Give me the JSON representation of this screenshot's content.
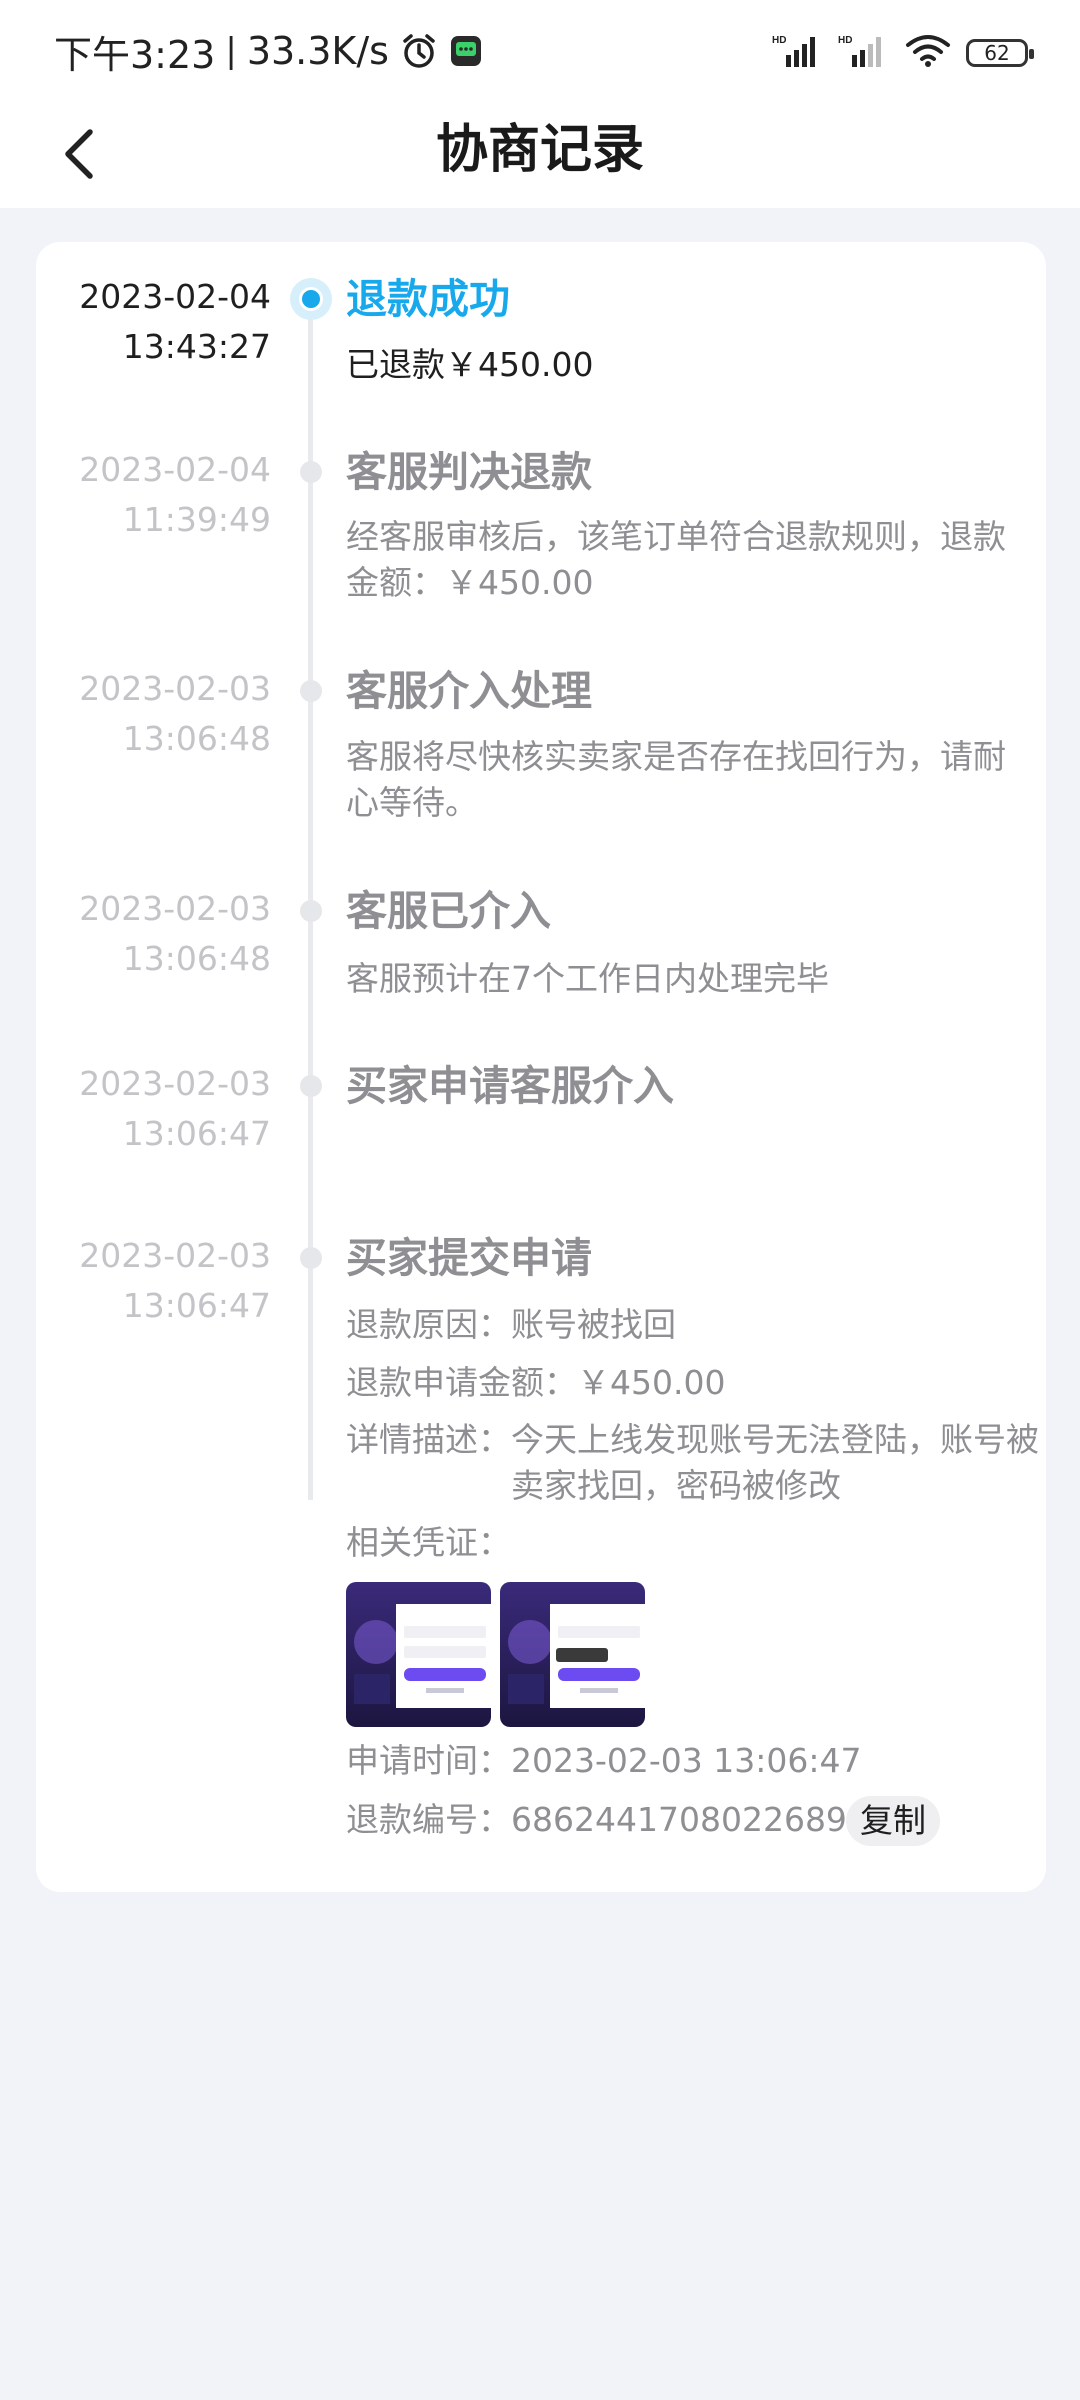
{
  "status_bar": {
    "time": "下午3:23",
    "separator": "|",
    "net_speed": "33.3K/s",
    "battery": "62",
    "signal_label_1": "HD",
    "signal_label_2": "HD"
  },
  "header": {
    "title": "协商记录"
  },
  "timeline": [
    {
      "date": "2023-02-04",
      "time": "13:43:27",
      "title": "退款成功",
      "text": "已退款￥450.00",
      "active": true
    },
    {
      "date": "2023-02-04",
      "time": "11:39:49",
      "title": "客服判决退款",
      "text": "经客服审核后，该笔订单符合退款规则，退款金额：￥450.00"
    },
    {
      "date": "2023-02-03",
      "time": "13:06:48",
      "title": "客服介入处理",
      "text": "客服将尽快核实卖家是否存在找回行为，请耐心等待。"
    },
    {
      "date": "2023-02-03",
      "time": "13:06:48",
      "title": "客服已介入",
      "text": "客服预计在7个工作日内处理完毕"
    },
    {
      "date": "2023-02-03",
      "time": "13:06:47",
      "title": "买家申请客服介入",
      "text": ""
    },
    {
      "date": "2023-02-03",
      "time": "13:06:47",
      "title": "买家提交申请",
      "text": ""
    }
  ],
  "application": {
    "reason_label": "退款原因：",
    "reason_value": "账号被找回",
    "amount_label": "退款申请金额：",
    "amount_value": "￥450.00",
    "desc_label": "详情描述：",
    "desc_value": "今天上线发现账号无法登陆，账号被卖家找回，密码被修改",
    "evidence_label": "相关凭证：",
    "time_label": "申请时间：",
    "time_value": "2023-02-03 13:06:47",
    "refund_no_label": "退款编号：",
    "refund_no_value": "6862441708022689",
    "copy_label": "复制"
  },
  "colors": {
    "accent": "#17a9ec",
    "muted": "#8e8e93",
    "background": "#f2f3f8"
  }
}
